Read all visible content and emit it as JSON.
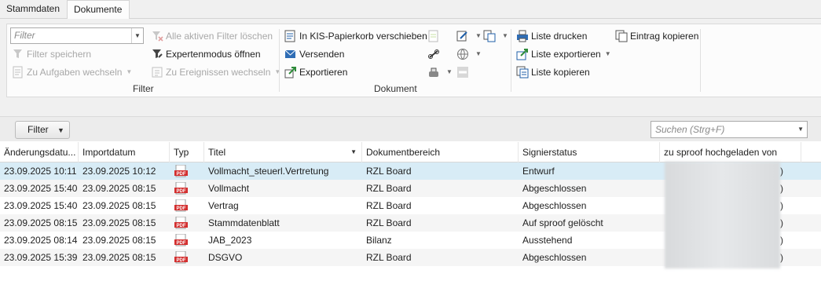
{
  "tabs": [
    {
      "label": "Stammdaten",
      "active": false
    },
    {
      "label": "Dokumente",
      "active": true
    }
  ],
  "ribbon": {
    "filter_group": {
      "label": "Filter",
      "filter_placeholder": "Filter",
      "clear_filters": "Alle aktiven Filter löschen",
      "save_filter": "Filter speichern",
      "expert_mode": "Expertenmodus öffnen",
      "switch_tasks": "Zu Aufgaben wechseln",
      "switch_events": "Zu Ereignissen wechseln"
    },
    "document_group": {
      "label": "Dokument",
      "recycle_bin": "In KIS-Papierkorb verschieben",
      "send": "Versenden",
      "export": "Exportieren"
    },
    "list_group": {
      "print_list": "Liste drucken",
      "export_list": "Liste exportieren",
      "copy_list": "Liste kopieren",
      "copy_entry": "Eintrag kopieren"
    }
  },
  "toolbar": {
    "filter_button": "Filter",
    "search_placeholder": "Suchen (Strg+F)"
  },
  "grid": {
    "columns": [
      "Änderungsdatu...",
      "Importdatum",
      "Typ",
      "Titel",
      "Dokumentbereich",
      "Signierstatus",
      "zu sproof hochgeladen von"
    ],
    "rows": [
      {
        "changed": "23.09.2025 10:11",
        "imported": "23.09.2025 10:12",
        "type": "pdf-icon",
        "title": "Vollmacht_steuerl.Vertretung",
        "area": "RZL Board",
        "status": "Entwurf",
        "uploader_suffix": ")"
      },
      {
        "changed": "23.09.2025 15:40",
        "imported": "23.09.2025 08:15",
        "type": "pdf-icon",
        "title": "Vollmacht",
        "area": "RZL Board",
        "status": "Abgeschlossen",
        "uploader_suffix": ")"
      },
      {
        "changed": "23.09.2025 15:40",
        "imported": "23.09.2025 08:15",
        "type": "pdf-icon",
        "title": "Vertrag",
        "area": "RZL Board",
        "status": "Abgeschlossen",
        "uploader_suffix": ")"
      },
      {
        "changed": "23.09.2025 08:15",
        "imported": "23.09.2025 08:15",
        "type": "pdf-icon",
        "title": "Stammdatenblatt",
        "area": "RZL Board",
        "status": "Auf sproof gelöscht",
        "uploader_suffix": ")"
      },
      {
        "changed": "23.09.2025 08:14",
        "imported": "23.09.2025 08:15",
        "type": "pdf-icon",
        "title": "JAB_2023",
        "area": "Bilanz",
        "status": "Ausstehend",
        "uploader_suffix": ")"
      },
      {
        "changed": "23.09.2025 15:39",
        "imported": "23.09.2025 08:15",
        "type": "pdf-icon",
        "title": "DSGVO",
        "area": "RZL Board",
        "status": "Abgeschlossen",
        "uploader_suffix": ")"
      }
    ]
  },
  "colors": {
    "selected_row": "#d8ecf6",
    "alt_row": "#f5f5f5",
    "ribbon_bg": "#f0f0f0",
    "pdf_red": "#d32f2f"
  }
}
